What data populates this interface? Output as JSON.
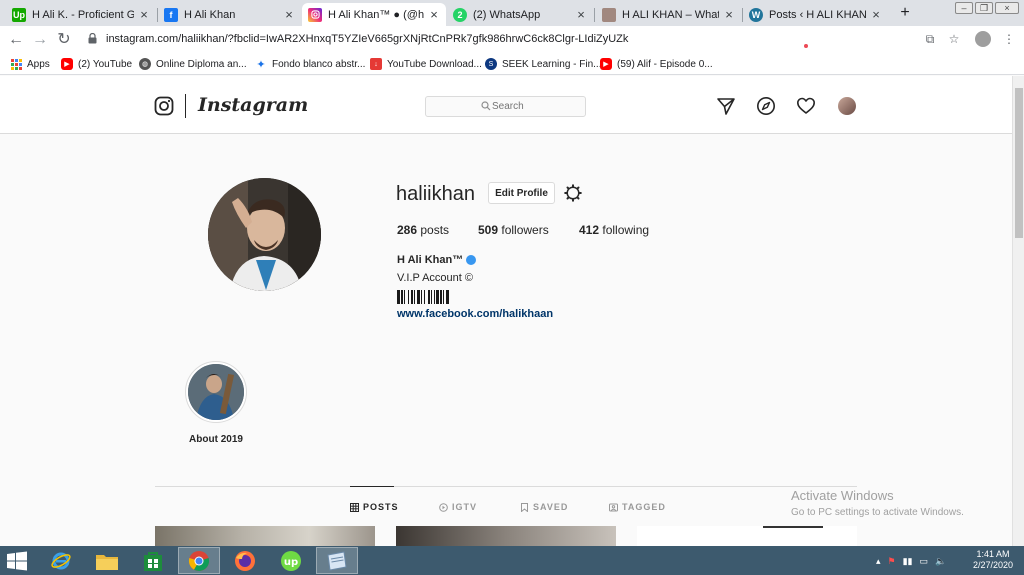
{
  "browser": {
    "tabs": [
      {
        "title": "H Ali K. - Proficient Graphic",
        "icon": "upwork-icon",
        "color": "#14a800",
        "glyph": "Up",
        "active": false
      },
      {
        "title": "H Ali Khan",
        "icon": "facebook-icon",
        "color": "#1877f2",
        "glyph": "f",
        "active": false
      },
      {
        "title": "H Ali Khan™ ● (@haliikhan)",
        "icon": "instagram-icon",
        "color": "#c13584",
        "glyph": "",
        "active": true
      },
      {
        "title": "(2) WhatsApp",
        "icon": "whatsapp-icon",
        "color": "#25d366",
        "glyph": "2",
        "active": false
      },
      {
        "title": "H ALI KHAN – Whats app",
        "icon": "person-icon",
        "color": "#8d6e63",
        "glyph": "",
        "active": false
      },
      {
        "title": "Posts ‹ H ALI KHAN — W",
        "icon": "wordpress-icon",
        "color": "#21759b",
        "glyph": "W",
        "active": false
      }
    ],
    "new_tab_label": "+",
    "url": "instagram.com/haliikhan/?fbclid=IwAR2XHnxqT5YZIeV665grXNjRtCnPRk7gfk986hrwC6ck8Clgr-LIdiZyUZk",
    "bookmarks": [
      {
        "label": "Apps",
        "icon": "apps-grid-icon",
        "color": "#ea4335"
      },
      {
        "label": "(2) YouTube",
        "icon": "youtube-icon",
        "color": "#ff0000"
      },
      {
        "label": "Online Diploma an...",
        "icon": "globe-icon",
        "color": "#555555"
      },
      {
        "label": "Fondo blanco abstr...",
        "icon": "bookmark-icon",
        "color": "#1a73e8"
      },
      {
        "label": "YouTube Download...",
        "icon": "download-icon",
        "color": "#e53935"
      },
      {
        "label": "SEEK Learning - Fin...",
        "icon": "seek-icon",
        "color": "#0d3880"
      },
      {
        "label": "(59) Alif - Episode 0...",
        "icon": "youtube-icon",
        "color": "#ff0000"
      }
    ]
  },
  "instagram": {
    "wordmark": "Instagram",
    "search_placeholder": "Search",
    "username": "haliikhan",
    "edit_profile_label": "Edit Profile",
    "stats": {
      "posts_count": "286",
      "posts_label": "posts",
      "followers_count": "509",
      "followers_label": "followers",
      "following_count": "412",
      "following_label": "following"
    },
    "full_name": "H Ali Khan™",
    "bio_line1": "V.I.P Account ©",
    "bio_link": "www.facebook.com/halikhaan",
    "highlight_label": "About 2019",
    "profile_tabs": [
      {
        "label": "POSTS",
        "icon": "grid-icon"
      },
      {
        "label": "IGTV",
        "icon": "igtv-icon"
      },
      {
        "label": "SAVED",
        "icon": "bookmark-icon"
      },
      {
        "label": "TAGGED",
        "icon": "tag-icon"
      }
    ],
    "accent_color": "#3897f0",
    "link_color": "#003569"
  },
  "windows": {
    "activate_title": "Activate Windows",
    "activate_sub": "Go to PC settings to activate Windows.",
    "clock_time": "1:41 AM",
    "clock_date": "2/27/2020"
  }
}
